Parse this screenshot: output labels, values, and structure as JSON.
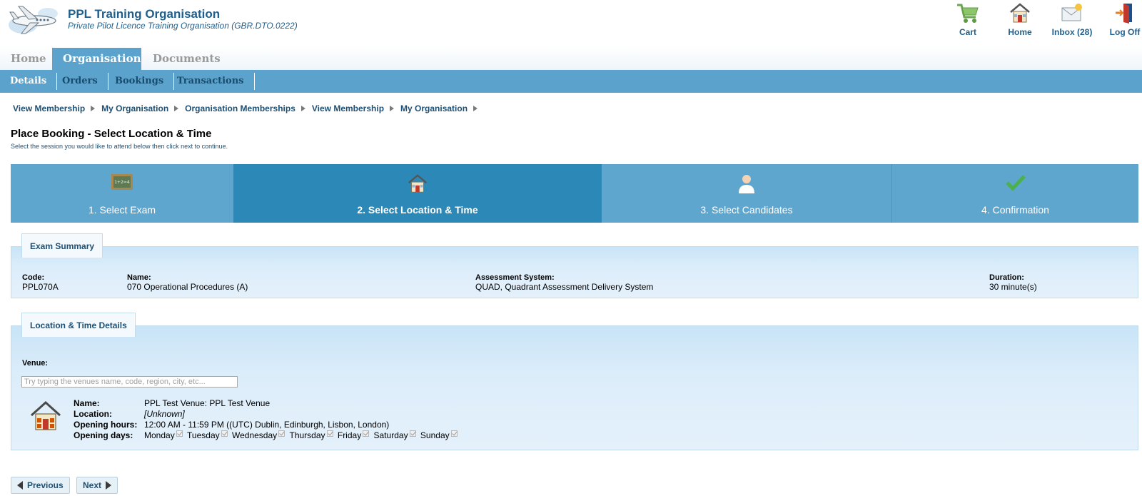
{
  "header": {
    "title": "PPL Training Organisation",
    "subtitle": "Private Pilot Licence Training Organisation (GBR.DTO.0222)"
  },
  "top_nav": {
    "cart": "Cart",
    "home": "Home",
    "inbox": "Inbox (28)",
    "logoff": "Log Off"
  },
  "main_tabs": [
    "Home",
    "Organisation",
    "Documents"
  ],
  "sub_tabs": [
    "Details",
    "Orders",
    "Bookings",
    "Transactions"
  ],
  "breadcrumb": [
    "View Membership",
    "My Organisation",
    "Organisation Memberships",
    "View Membership",
    "My Organisation"
  ],
  "page": {
    "title": "Place Booking - Select Location & Time",
    "description": "Select the session you would like to attend below then click next to continue."
  },
  "steps": [
    "1. Select Exam",
    "2. Select Location & Time",
    "3. Select Candidates",
    "4. Confirmation"
  ],
  "exam_summary": {
    "tab": "Exam Summary",
    "code_label": "Code:",
    "code": "PPL070A",
    "name_label": "Name:",
    "name": "070 Operational Procedures (A)",
    "system_label": "Assessment System:",
    "system": "QUAD, Quadrant Assessment Delivery System",
    "duration_label": "Duration:",
    "duration": "30 minute(s)"
  },
  "location": {
    "tab": "Location & Time Details",
    "venue_label": "Venue:",
    "venue_placeholder": "Try typing the venues name, code, region, city, etc...",
    "name_label": "Name:",
    "name": "PPL Test Venue: PPL Test Venue",
    "location_label": "Location:",
    "location": "[Unknown]",
    "hours_label": "Opening hours:",
    "hours": "12:00 AM - 11:59 PM ((UTC) Dublin, Edinburgh, Lisbon, London)",
    "days_label": "Opening days:",
    "days": [
      "Monday",
      "Tuesday",
      "Wednesday",
      "Thursday",
      "Friday",
      "Saturday",
      "Sunday"
    ]
  },
  "buttons": {
    "previous": "Previous",
    "next": "Next"
  },
  "colors": {
    "tab_blue": "#5ba3cc",
    "active_step": "#2c88b6",
    "title_blue": "#1f5f8c"
  }
}
